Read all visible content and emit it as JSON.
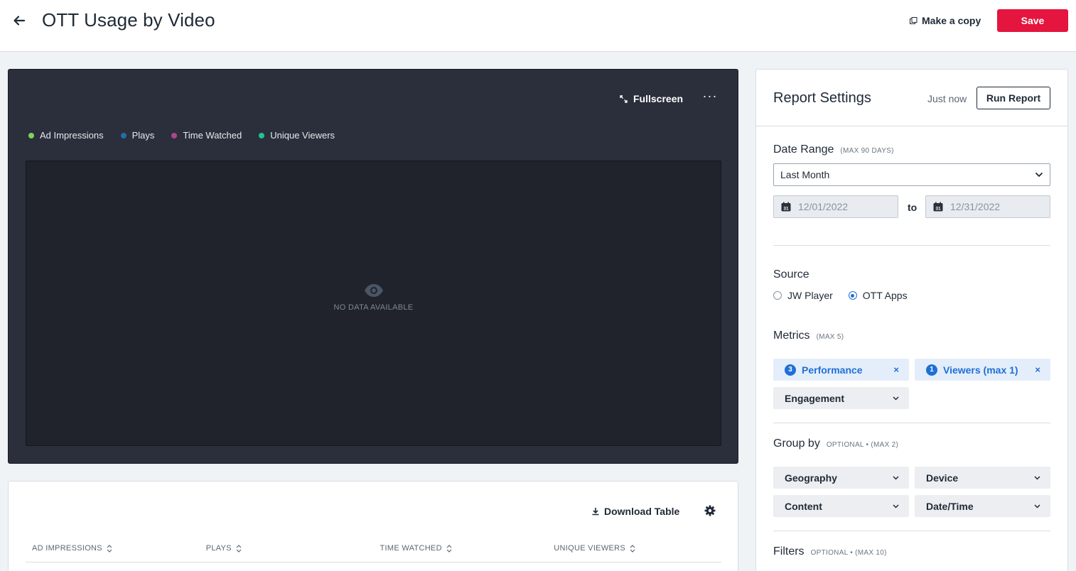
{
  "header": {
    "title": "OTT Usage by Video",
    "copy_label": "Make a copy",
    "save_label": "Save",
    "accent_color": "#e4153e"
  },
  "chart_card": {
    "fullscreen_label": "Fullscreen",
    "more_label": "···",
    "legend": [
      {
        "label": "Ad Impressions",
        "color": "#7fd35b"
      },
      {
        "label": "Plays",
        "color": "#1f6fa8"
      },
      {
        "label": "Time Watched",
        "color": "#a8488c"
      },
      {
        "label": "Unique Viewers",
        "color": "#1fc391"
      }
    ],
    "empty_state": "NO DATA AVAILABLE"
  },
  "chart_data": {
    "type": "line",
    "series": [
      {
        "name": "Ad Impressions",
        "values": []
      },
      {
        "name": "Plays",
        "values": []
      },
      {
        "name": "Time Watched",
        "values": []
      },
      {
        "name": "Unique Viewers",
        "values": []
      }
    ],
    "empty": true,
    "legend": "top-left"
  },
  "table": {
    "download_label": "Download Table",
    "columns": [
      "AD IMPRESSIONS",
      "PLAYS",
      "TIME WATCHED",
      "UNIQUE VIEWERS"
    ]
  },
  "settings": {
    "title": "Report Settings",
    "last_run": "Just now",
    "run_label": "Run Report",
    "date_range": {
      "label": "Date Range",
      "hint": "(MAX 90 DAYS)",
      "selected": "Last Month",
      "start": "12/01/2022",
      "end": "12/31/2022",
      "to_label": "to",
      "calendar_day": "31"
    },
    "source": {
      "label": "Source",
      "options": [
        {
          "label": "JW Player",
          "checked": false
        },
        {
          "label": "OTT Apps",
          "checked": true
        }
      ]
    },
    "metrics": {
      "label": "Metrics",
      "hint": "(MAX 5)",
      "chips": [
        {
          "count": "3",
          "label": "Performance",
          "remove": "×"
        },
        {
          "count": "1",
          "label": "Viewers (max 1)",
          "remove": "×"
        },
        {
          "label": "Engagement"
        }
      ]
    },
    "group_by": {
      "label": "Group by",
      "hint": "OPTIONAL • (MAX 2)",
      "options": [
        "Geography",
        "Device",
        "Content",
        "Date/Time"
      ]
    },
    "filters": {
      "label": "Filters",
      "hint": "OPTIONAL • (MAX 10)"
    }
  }
}
